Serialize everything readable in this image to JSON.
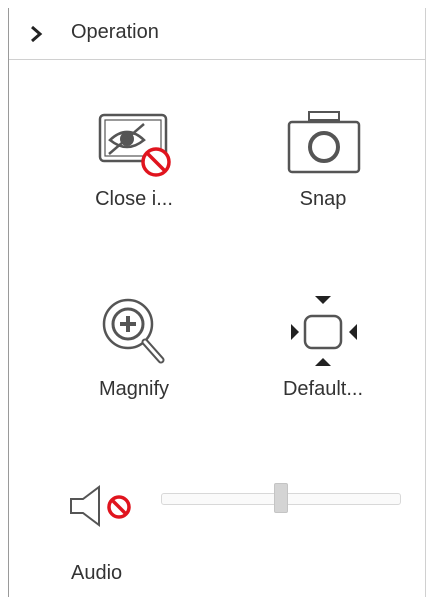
{
  "header": {
    "title": "Operation",
    "toggle_icon": "chevron-right-icon"
  },
  "operations": [
    {
      "label": "Close i...",
      "icon": "close-image-icon"
    },
    {
      "label": "Snap",
      "icon": "camera-icon"
    },
    {
      "label": "Magnify",
      "icon": "magnify-icon"
    },
    {
      "label": "Default...",
      "icon": "default-view-icon"
    }
  ],
  "audio": {
    "label": "Audio",
    "icon": "speaker-muted-icon",
    "volume_fraction": 0.5
  },
  "colors": {
    "mute_red": "#e0141e",
    "icon_gray": "#555555"
  }
}
